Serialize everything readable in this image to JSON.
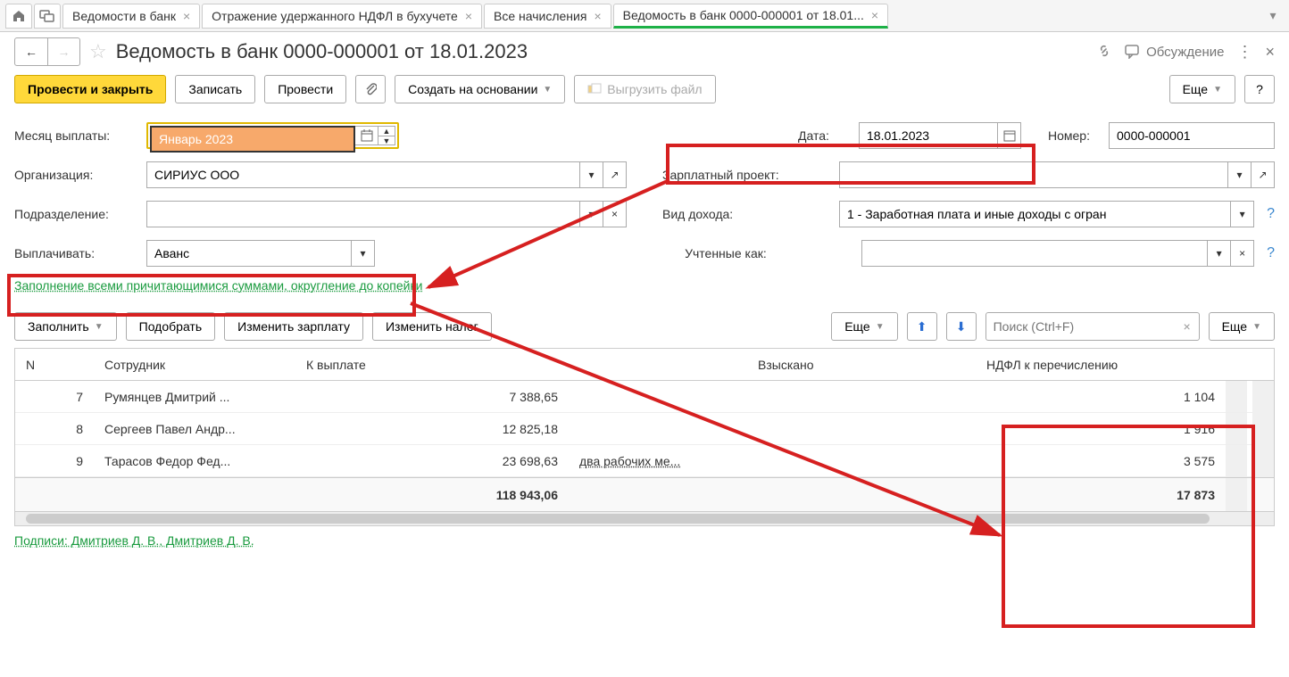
{
  "tabs": {
    "items": [
      {
        "label": "Ведомости в банк"
      },
      {
        "label": "Отражение удержанного НДФЛ в бухучете"
      },
      {
        "label": "Все начисления"
      },
      {
        "label": "Ведомость в банк 0000-000001 от 18.01..."
      }
    ]
  },
  "header": {
    "title": "Ведомость в банк 0000-000001 от 18.01.2023",
    "discuss": "Обсуждение"
  },
  "toolbar": {
    "post_close": "Провести и закрыть",
    "save": "Записать",
    "post": "Провести",
    "create_based": "Создать на основании",
    "export": "Выгрузить файл",
    "more": "Еще",
    "help": "?"
  },
  "form": {
    "month_label": "Месяц выплаты:",
    "month_value": "Январь 2023",
    "date_label": "Дата:",
    "date_value": "18.01.2023",
    "number_label": "Номер:",
    "number_value": "0000-000001",
    "org_label": "Организация:",
    "org_value": "СИРИУС ООО",
    "proj_label": "Зарплатный проект:",
    "proj_value": "",
    "dept_label": "Подразделение:",
    "dept_value": "",
    "income_label": "Вид дохода:",
    "income_value": "1 - Заработная плата и иные доходы с огран",
    "pay_label": "Выплачивать:",
    "pay_value": "Аванс",
    "acct_label": "Учтенные как:",
    "acct_value": "",
    "fill_link": "Заполнение всеми причитающимися суммами, округление до копейки"
  },
  "table_toolbar": {
    "fill": "Заполнить",
    "pick": "Подобрать",
    "change_salary": "Изменить зарплату",
    "change_tax": "Изменить налог",
    "more1": "Еще",
    "search_ph": "Поиск (Ctrl+F)",
    "more2": "Еще"
  },
  "table": {
    "headers": {
      "n": "N",
      "emp": "Сотрудник",
      "pay": "К выплате",
      "col": "Взыскано",
      "tax": "НДФЛ к перечислению"
    },
    "rows": [
      {
        "n": "7",
        "emp": "Румянцев Дмитрий ...",
        "pay": "7 388,65",
        "note": "",
        "col": "",
        "tax": "1 104"
      },
      {
        "n": "8",
        "emp": "Сергеев Павел Андр...",
        "pay": "12 825,18",
        "note": "",
        "col": "",
        "tax": "1 916"
      },
      {
        "n": "9",
        "emp": "Тарасов Федор Фед...",
        "pay": "23 698,63",
        "note": "два рабочих ме...",
        "col": "",
        "tax": "3 575"
      }
    ],
    "totals": {
      "pay": "118 943,06",
      "tax": "17 873"
    }
  },
  "footer": {
    "sign": "Подписи: Дмитриев Д. В., Дмитриев Д. В."
  }
}
